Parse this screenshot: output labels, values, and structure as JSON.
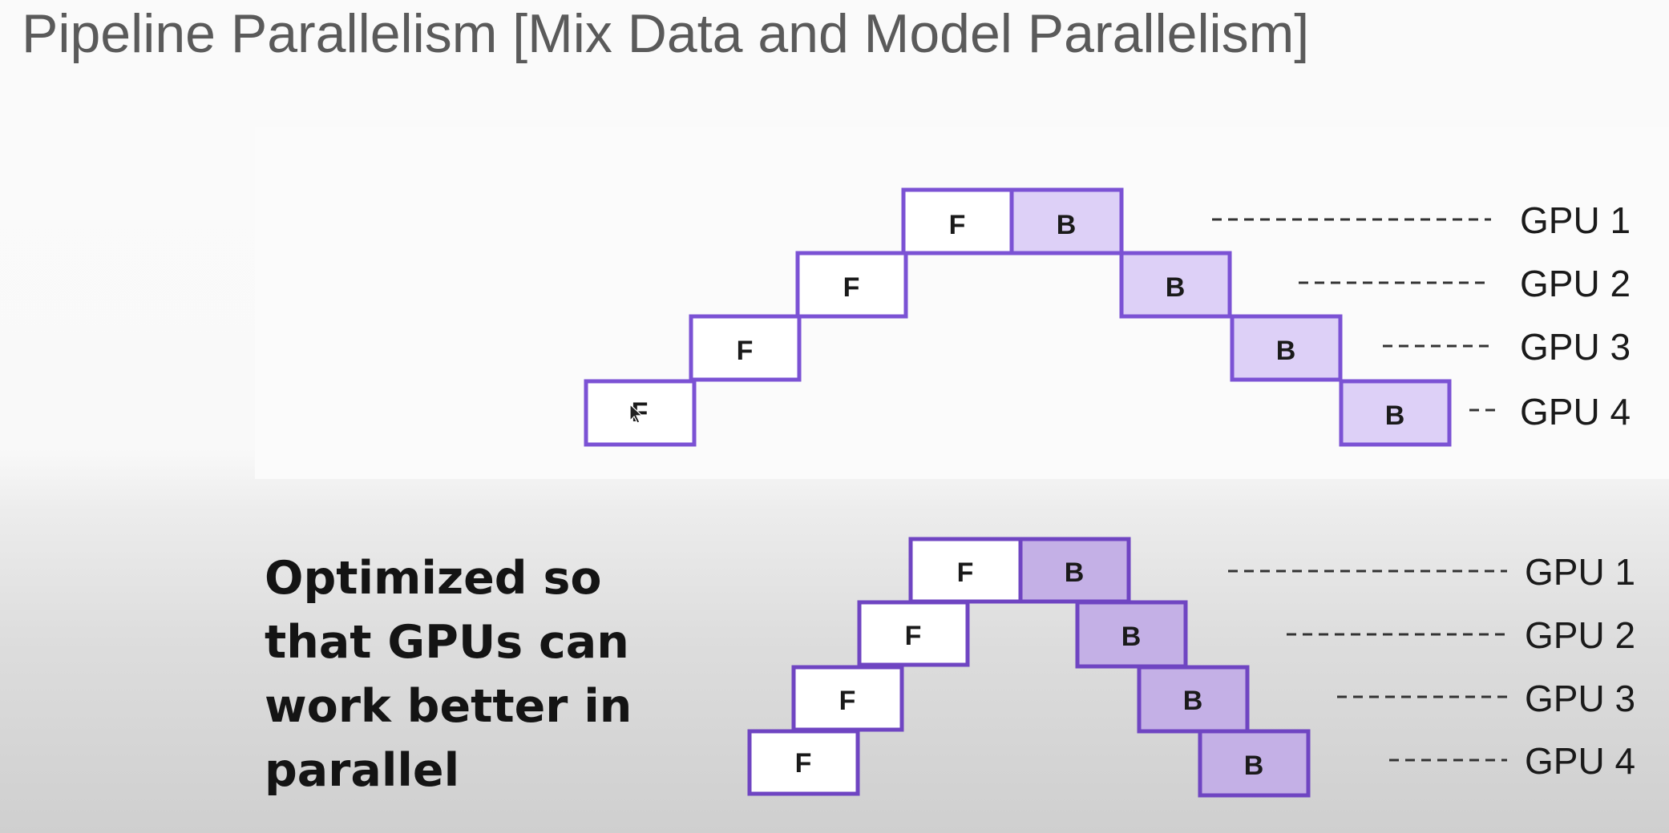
{
  "title": "Pipeline Parallelism [Mix Data and Model Parallelism]",
  "caption": "Optimized so that GPUs can work better in parallel",
  "colors": {
    "title_text": "#5a5a5a",
    "cell_border": "#7b52d4",
    "top_backward_fill": "#ddd0f7",
    "bottom_border": "#6f45c2",
    "bottom_backward_fill": "#c4b0e6",
    "leader_line": "#333333"
  },
  "top_diagram": {
    "forward_label": "F",
    "backward_label": "B",
    "rows": [
      {
        "gpu": "GPU 1"
      },
      {
        "gpu": "GPU 2"
      },
      {
        "gpu": "GPU 3"
      },
      {
        "gpu": "GPU 4"
      }
    ]
  },
  "bottom_diagram": {
    "forward_label": "F",
    "backward_label": "B",
    "rows": [
      {
        "gpu": "GPU 1"
      },
      {
        "gpu": "GPU 2"
      },
      {
        "gpu": "GPU 3"
      },
      {
        "gpu": "GPU 4"
      }
    ]
  },
  "icons": {
    "cursor": "mouse-pointer-icon"
  }
}
